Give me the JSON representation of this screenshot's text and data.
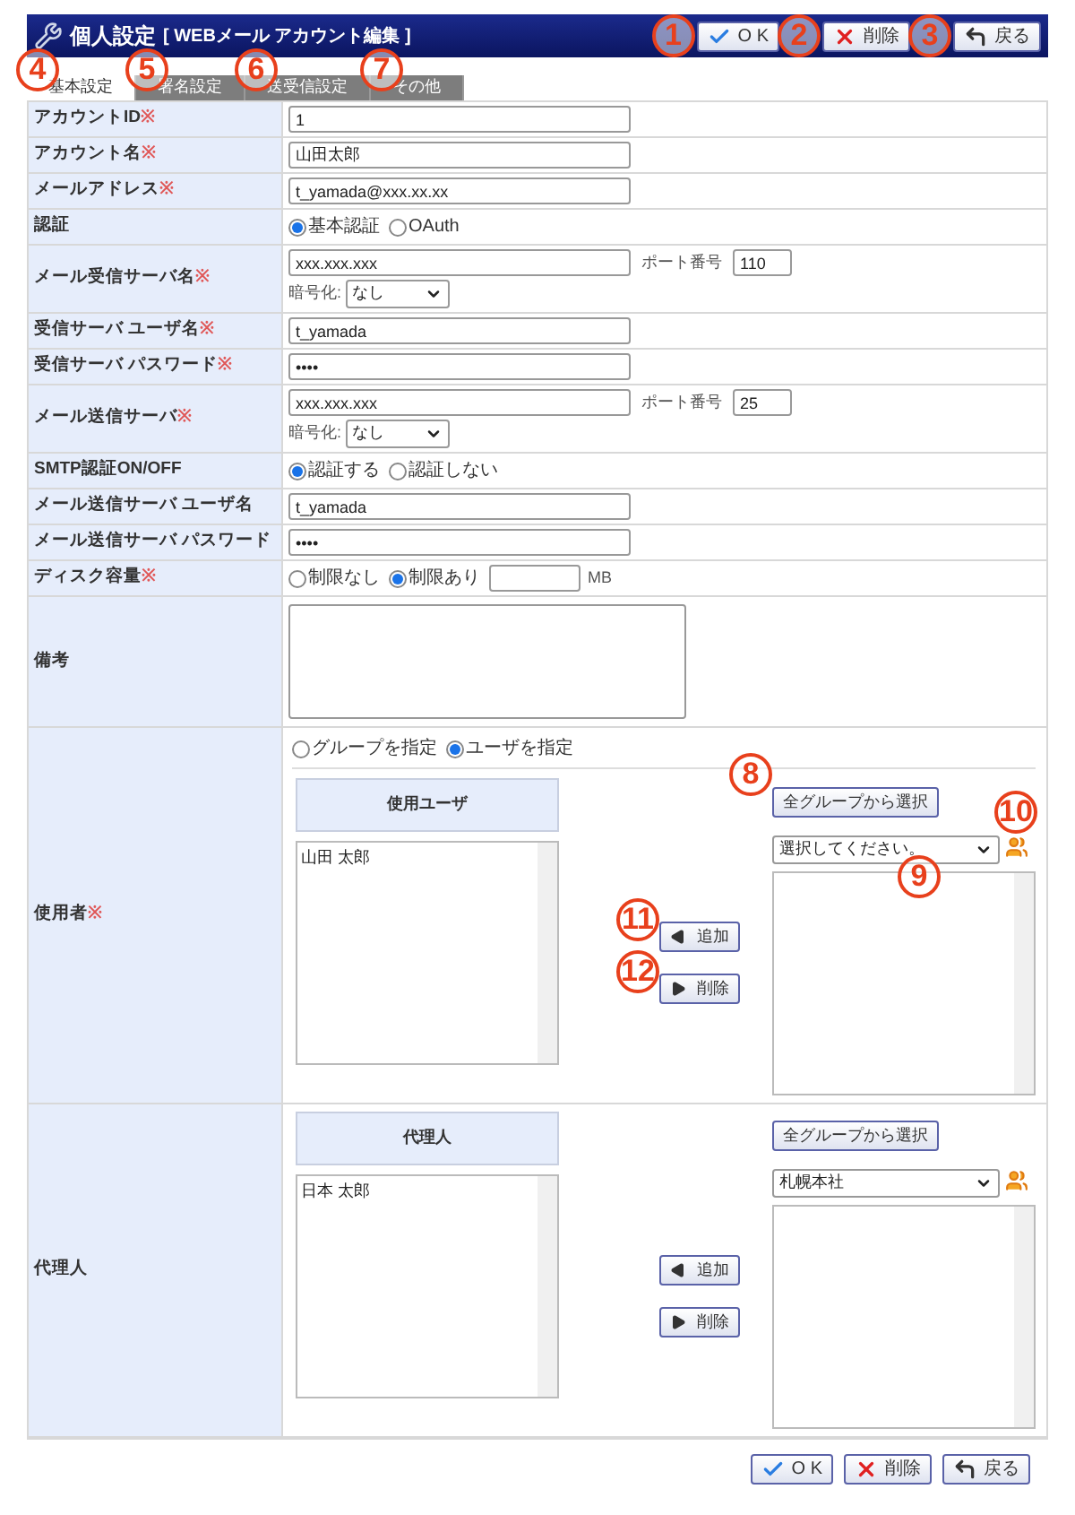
{
  "header": {
    "title": "個人設定",
    "subtitle": "[ WEBメール アカウント編集 ]"
  },
  "top_buttons": [
    {
      "kind": "ok",
      "label": "O K",
      "callout": "1"
    },
    {
      "kind": "delete",
      "label": "削除",
      "callout": "2"
    },
    {
      "kind": "back",
      "label": "戻る",
      "callout": "3"
    }
  ],
  "tabs": [
    {
      "label": "基本設定",
      "selected": true,
      "callout": "4"
    },
    {
      "label": "署名設定",
      "selected": false,
      "callout": "5"
    },
    {
      "label": "送受信設定",
      "selected": false,
      "callout": "6"
    },
    {
      "label": "その他",
      "selected": false,
      "callout": "7"
    }
  ],
  "rows": [
    {
      "kind": "text",
      "label": "アカウントID",
      "required_mark": "※",
      "value": "1"
    },
    {
      "kind": "text",
      "label": "アカウント名",
      "required_mark": "※",
      "value": "山田太郎"
    },
    {
      "kind": "text",
      "label": "メールアドレス",
      "required_mark": "※",
      "value": "t_yamada@xxx.xx.xx"
    },
    {
      "kind": "radio",
      "label": "認証",
      "options": [
        {
          "label": "基本認証",
          "selected": true
        },
        {
          "label": "OAuth",
          "selected": false
        }
      ]
    },
    {
      "kind": "server",
      "label": "メール受信サーバ名",
      "required_mark": "※",
      "value": "xxx.xxx.xxx",
      "port_label": "ポート番号",
      "port": "110",
      "enc_label": "暗号化:",
      "enc": "なし"
    },
    {
      "kind": "text",
      "label": "受信サーバ ユーザ名",
      "required_mark": "※",
      "value": "t_yamada"
    },
    {
      "kind": "text",
      "label": "受信サーバ パスワード",
      "required_mark": "※",
      "value": "••••"
    },
    {
      "kind": "server",
      "label": "メール送信サーバ",
      "required_mark": "※",
      "value": "xxx.xxx.xxx",
      "port_label": "ポート番号",
      "port": "25",
      "enc_label": "暗号化:",
      "enc": "なし"
    },
    {
      "kind": "radio",
      "label": "SMTP認証ON/OFF",
      "options": [
        {
          "label": "認証する",
          "selected": true
        },
        {
          "label": "認証しない",
          "selected": false
        }
      ]
    },
    {
      "kind": "text",
      "label": "メール送信サーバ ユーザ名",
      "value": "t_yamada"
    },
    {
      "kind": "text",
      "label": "メール送信サーバ パスワード",
      "value": "••••"
    },
    {
      "kind": "disk",
      "label": "ディスク容量",
      "required_mark": "※",
      "options": [
        {
          "label": "制限なし",
          "selected": false
        },
        {
          "label": "制限あり",
          "selected": true
        }
      ],
      "unit": "MB"
    },
    {
      "kind": "textarea",
      "label": "備考"
    },
    {
      "kind": "users",
      "label": "使用者",
      "required_mark": "※",
      "options": [
        {
          "label": "グループを指定",
          "selected": false
        },
        {
          "label": "ユーザを指定",
          "selected": true
        }
      ],
      "list_title": "使用ユーザ",
      "items": [
        "山田 太郎"
      ],
      "group_button": {
        "label": "全グループから選択",
        "callout": "8"
      },
      "select": {
        "value": "選択してください。",
        "callout": "9"
      },
      "group_icon_callout": "10",
      "add": {
        "label": "追加",
        "callout": "11"
      },
      "remove": {
        "label": "削除",
        "callout": "12"
      }
    },
    {
      "kind": "users",
      "label": "代理人",
      "list_title": "代理人",
      "items": [
        "日本 太郎"
      ],
      "group_button": {
        "label": "全グループから選択"
      },
      "select": {
        "value": "札幌本社"
      },
      "add": {
        "label": "追加"
      },
      "remove": {
        "label": "削除"
      }
    }
  ],
  "bottom_buttons": [
    {
      "kind": "ok",
      "label": "O K"
    },
    {
      "kind": "delete",
      "label": "削除"
    },
    {
      "kind": "back",
      "label": "戻る"
    }
  ]
}
